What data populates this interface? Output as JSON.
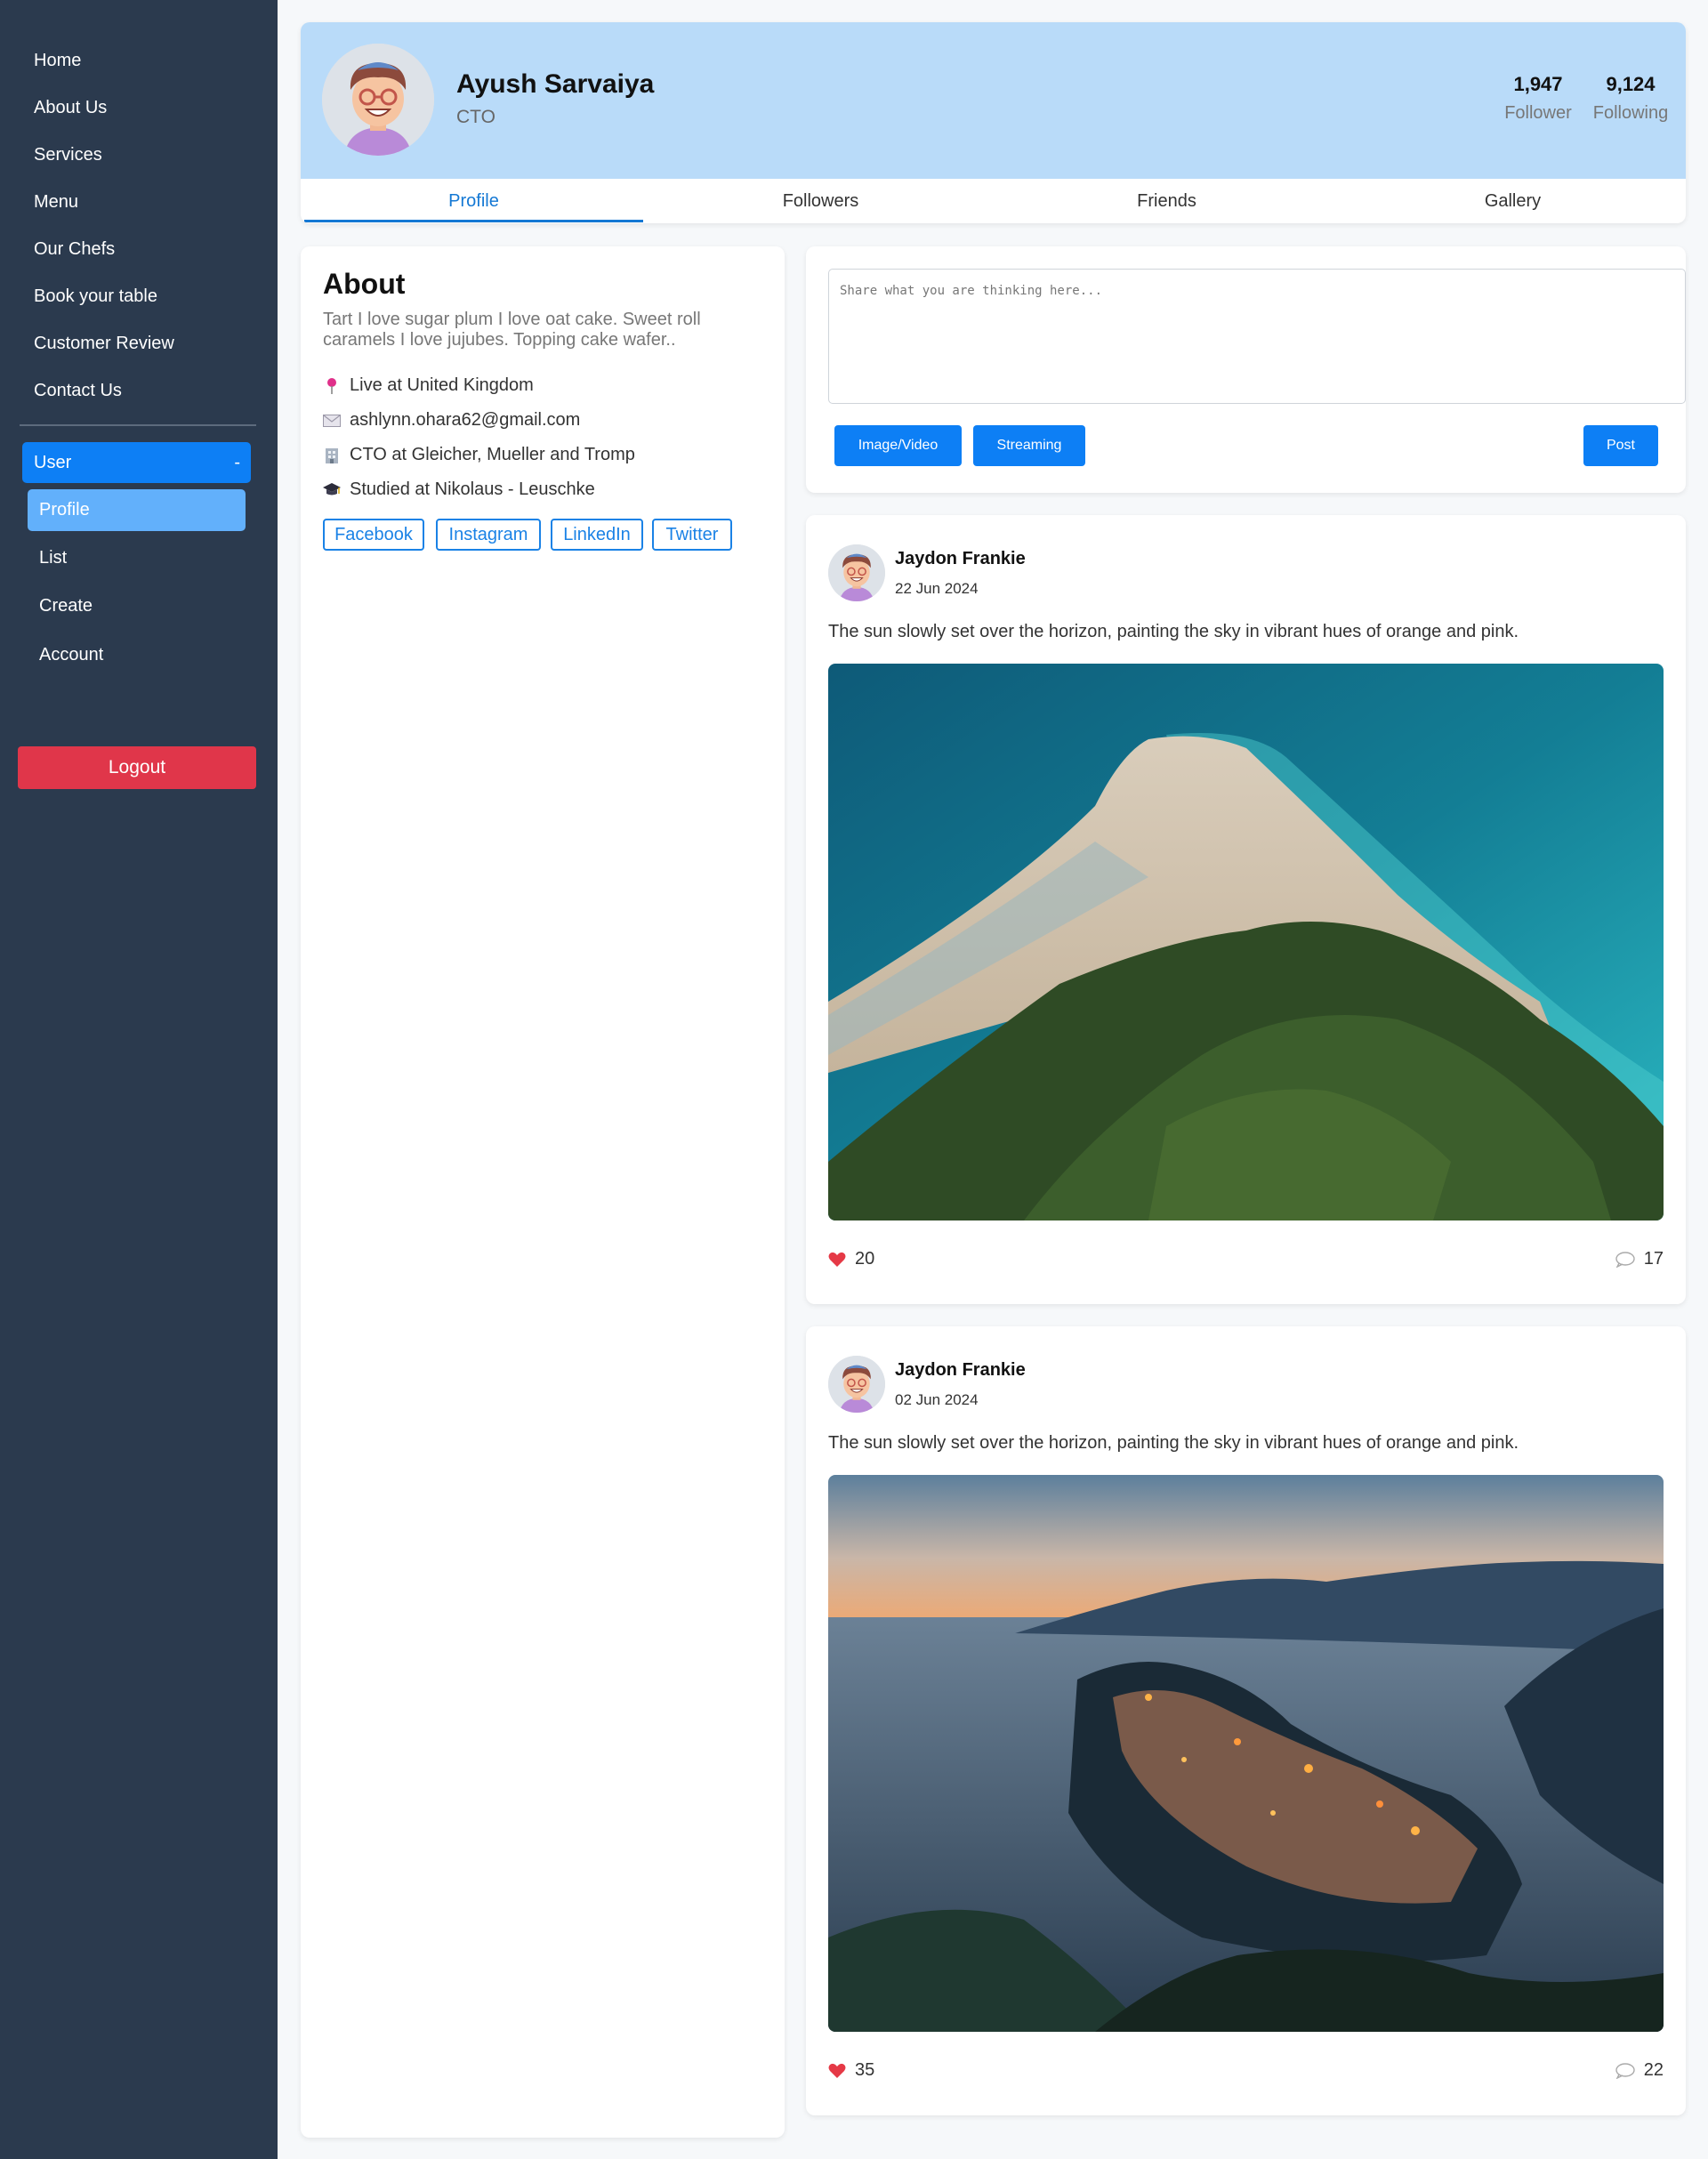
{
  "sidebar": {
    "nav": [
      "Home",
      "About Us",
      "Services",
      "Menu",
      "Our Chefs",
      "Book your table",
      "Customer Review",
      "Contact Us"
    ],
    "user_label": "User",
    "user_toggle_symbol": "-",
    "sub": [
      "Profile",
      "List",
      "Create",
      "Account"
    ],
    "logout": "Logout"
  },
  "profile": {
    "name": "Ayush Sarvaiya",
    "role": "CTO",
    "follower_count": "1,947",
    "follower_label": "Follower",
    "following_count": "9,124",
    "following_label": "Following"
  },
  "tabs": [
    "Profile",
    "Followers",
    "Friends",
    "Gallery"
  ],
  "about": {
    "title": "About",
    "bio": "Tart I love sugar plum I love oat cake. Sweet roll caramels I love jujubes. Topping cake wafer..",
    "location": "Live at United Kingdom",
    "email": "ashlynn.ohara62@gmail.com",
    "work": "CTO at Gleicher, Mueller and Tromp",
    "education": "Studied at Nikolaus - Leuschke",
    "socials": [
      "Facebook",
      "Instagram",
      "LinkedIn",
      "Twitter"
    ]
  },
  "composer": {
    "placeholder": "Share what you are thinking here...",
    "image_button": "Image/Video",
    "streaming_button": "Streaming",
    "post_button": "Post"
  },
  "posts": [
    {
      "author": "Jaydon Frankie",
      "date": "22 Jun 2024",
      "text": "The sun slowly set over the horizon, painting the sky in vibrant hues of orange and pink.",
      "likes": "20",
      "comments": "17"
    },
    {
      "author": "Jaydon Frankie",
      "date": "02 Jun 2024",
      "text": "The sun slowly set over the horizon, painting the sky in vibrant hues of orange and pink.",
      "likes": "35",
      "comments": "22"
    }
  ],
  "colors": {
    "sidebar_bg": "#2b3a4e",
    "accent": "#0d7ff5",
    "banner": "#b9dbf9",
    "logout": "#e0364a",
    "like": "#e53946"
  },
  "icons": {
    "location": "pin-icon",
    "email": "mail-icon",
    "work": "building-icon",
    "education": "graduation-cap-icon",
    "like": "heart-icon",
    "comment": "comment-bubble-icon"
  }
}
